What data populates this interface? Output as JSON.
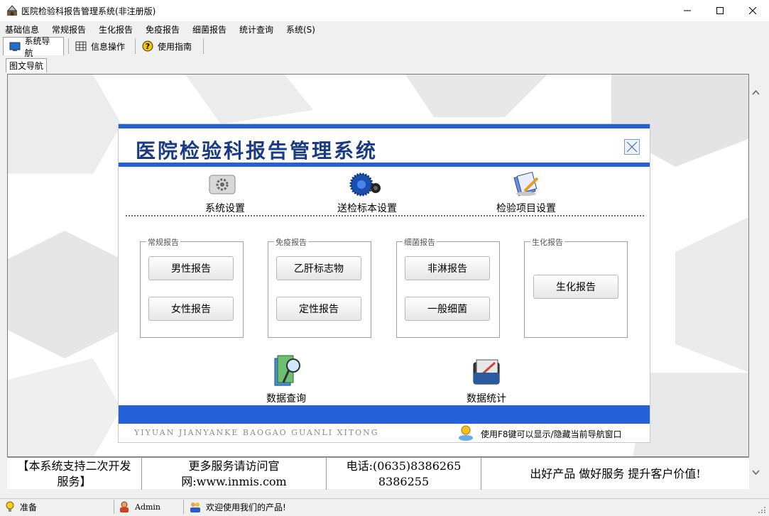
{
  "window": {
    "title": "医院检验科报告管理系统(非注册版)"
  },
  "menu": [
    "基础信息",
    "常规报告",
    "生化报告",
    "免疫报告",
    "细菌报告",
    "统计查询",
    "系统(S)"
  ],
  "toolbar": {
    "tabs": [
      {
        "label": "系统导航",
        "icon": "monitor-icon"
      },
      {
        "label": "信息操作",
        "icon": "grid-icon"
      },
      {
        "label": "使用指南",
        "icon": "help-icon"
      }
    ]
  },
  "inner_tab": "图文导航",
  "panel": {
    "title": "医院检验科报告管理系统",
    "top_links": [
      {
        "label": "系统设置",
        "icon": "gear-icon"
      },
      {
        "label": "送检标本设置",
        "icon": "saw-blade-icon"
      },
      {
        "label": "检验项目设置",
        "icon": "document-pen-icon"
      }
    ],
    "groups": [
      {
        "title": "常规报告",
        "buttons": [
          "男性报告",
          "女性报告"
        ]
      },
      {
        "title": "免疫报告",
        "buttons": [
          "乙肝标志物",
          "定性报告"
        ]
      },
      {
        "title": "细菌报告",
        "buttons": [
          "非淋报告",
          "一般细菌"
        ]
      },
      {
        "title": "生化报告",
        "buttons": [
          "生化报告"
        ]
      }
    ],
    "bottom_links": [
      {
        "label": "数据查询",
        "icon": "book-magnifier-icon"
      },
      {
        "label": "数据统计",
        "icon": "folder-chart-icon"
      }
    ],
    "footer_pinyin": "YIYUAN JIANYANKE BAOGAO GUANLI XITONG",
    "footer_hint": "使用F8键可以显示/隐藏当前导航窗口"
  },
  "footer": {
    "support": "【本系统支持二次开发服务】",
    "website_line1": "更多服务请访问官",
    "website_line2": "网:www.inmis.com",
    "phone_line1": "电话:(0635)8386265",
    "phone_line2": "8386255",
    "slogan": "出好产品 做好服务 提升客户价值!"
  },
  "status": {
    "ready": "准备",
    "user": "Admin",
    "welcome": "欢迎使用我们的产品!"
  },
  "colors": {
    "accent": "#2460d8",
    "title": "#1a3b84"
  }
}
